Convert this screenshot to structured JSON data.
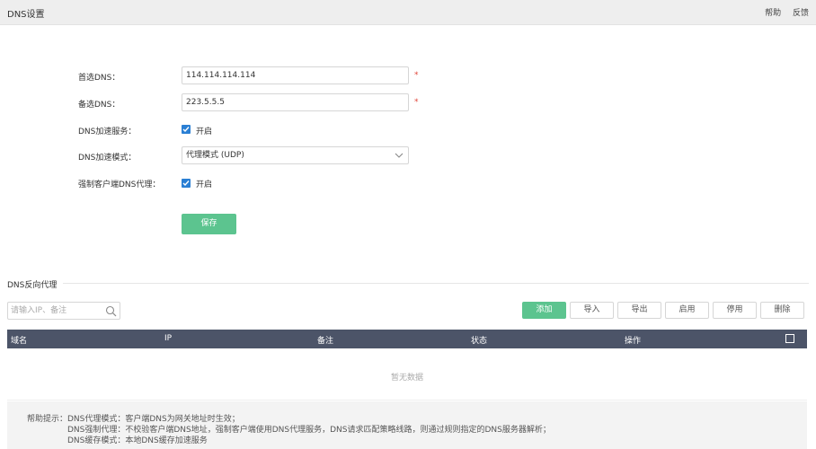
{
  "header": {
    "title": "DNS设置",
    "help": "帮助",
    "feedback": "反馈"
  },
  "form": {
    "primary_dns": {
      "label": "首选DNS：",
      "value": "114.114.114.114",
      "required": "*"
    },
    "secondary_dns": {
      "label": "备选DNS：",
      "value": "223.5.5.5",
      "required": "*"
    },
    "accel_service": {
      "label": "DNS加速服务：",
      "checked": true,
      "option": "开启"
    },
    "accel_mode": {
      "label": "DNS加速模式：",
      "value": "代理模式 (UDP)"
    },
    "force_proxy": {
      "label": "强制客户端DNS代理：",
      "checked": true,
      "option": "开启"
    },
    "save": "保存"
  },
  "reverse_proxy": {
    "title": "DNS反向代理",
    "search_placeholder": "请输入IP、备注",
    "buttons": {
      "add": "添加",
      "import": "导入",
      "export": "导出",
      "enable": "启用",
      "disable": "停用",
      "delete": "删除"
    },
    "columns": [
      "域名",
      "IP",
      "备注",
      "状态",
      "操作"
    ],
    "empty_text": "暂无数据"
  },
  "help": {
    "label": "帮助提示：",
    "lines": [
      "DNS代理模式：客户端DNS为网关地址时生效；",
      "DNS强制代理：不校验客户端DNS地址，强制客户端使用DNS代理服务，DNS请求匹配策略线路，则通过规则指定的DNS服务器解析；",
      "DNS缓存模式：本地DNS缓存加速服务"
    ]
  },
  "colors": {
    "accent_green": "#5cc48f",
    "table_header": "#4c5468",
    "checkbox_blue": "#2a7fd4",
    "required_red": "#e0463a"
  }
}
